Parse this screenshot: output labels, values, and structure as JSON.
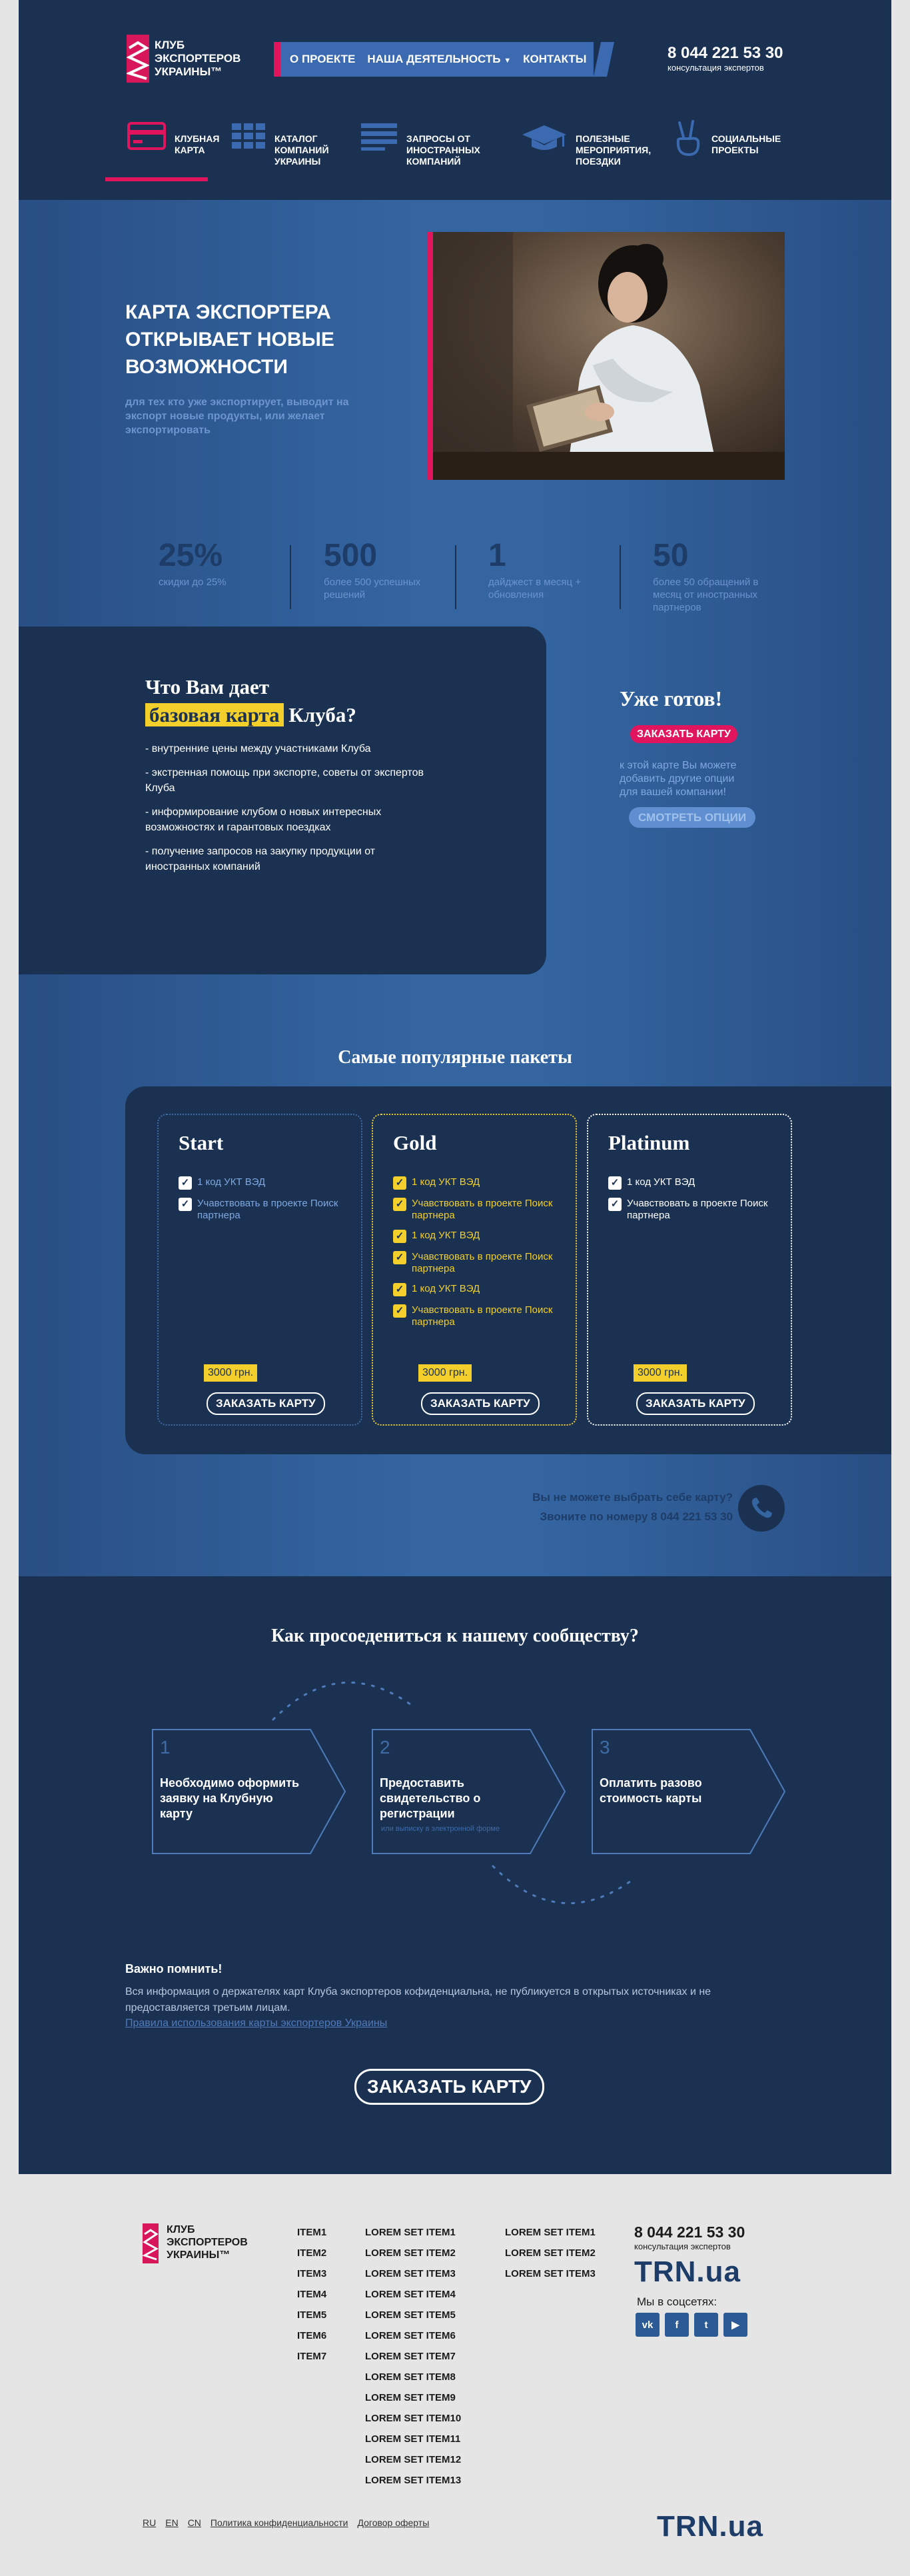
{
  "header": {
    "logo_lines": [
      "КЛУБ",
      "ЭКСПОРТЕРОВ",
      "УКРАИНЫ™"
    ],
    "nav": [
      "О ПРОЕКТЕ",
      "НАША ДЕЯТЕЛЬНОСТЬ",
      "КОНТАКТЫ"
    ],
    "phone": "8 044 221 53 30",
    "phone_caption": "консультация экспертов"
  },
  "services": [
    {
      "label": "КЛУБНАЯ КАРТА",
      "icon": "card-icon"
    },
    {
      "label": "КАТАЛОГ КОМПАНИЙ УКРАИНЫ",
      "icon": "grid-icon"
    },
    {
      "label": "ЗАПРОСЫ ОТ ИНОСТРАННЫХ КОМПАНИЙ",
      "icon": "list-icon"
    },
    {
      "label": "ПОЛЕЗНЫЕ МЕРОПРИЯТИЯ, ПОЕЗДКИ",
      "icon": "graduation-cap-icon"
    },
    {
      "label": "СОЦИАЛЬНЫЕ ПРОЕКТЫ",
      "icon": "peace-hand-icon"
    }
  ],
  "hero": {
    "title_lines": [
      "КАРТА ЭКСПОРТЕРА",
      "ОТКРЫВАЕТ НОВЫЕ",
      "ВОЗМОЖНОСТИ"
    ],
    "subtitle": "для тех кто уже экспортирует, выводит на экспорт новые продукты, или желает экспортировать"
  },
  "stats": [
    {
      "value": "25%",
      "label": "скидки до 25%"
    },
    {
      "value": "500",
      "label": "более 500 успешных решений"
    },
    {
      "value": "1",
      "label": "дайджест в месяц + обновления"
    },
    {
      "value": "50",
      "label": "более 50 обращений в месяц от иностранных партнеров"
    }
  ],
  "basic": {
    "title_before": "Что Вам дает",
    "title_highlight": "базовая карта",
    "title_after": "Клуба?",
    "items": [
      "- внутренние цены между участниками Клуба",
      "- экстренная помощь при экспорте, советы от экспертов Клуба",
      "- информирование клубом о новых интересных возможностях и гарантовых поездках",
      "- получение запросов на закупку продукции от иностранных компаний"
    ]
  },
  "ready": {
    "title": "Уже готов!",
    "order": "ЗАКАЗАТЬ КАРТУ",
    "note": "к этой карте Вы можете добавить другие опции для вашей компании!",
    "options": "СМОТРЕТЬ ОПЦИИ"
  },
  "packages": {
    "title": "Самые популярные пакеты",
    "items": [
      {
        "name": "Start",
        "features": [
          "1 код УКТ ВЭД",
          "Учавствовать в проекте Поиск партнера"
        ],
        "price": "3000 грн.",
        "button": "ЗАКАЗАТЬ КАРТУ"
      },
      {
        "name": "Gold",
        "features": [
          "1 код УКТ ВЭД",
          "Учавствовать в проекте Поиск партнера",
          "1 код УКТ ВЭД",
          "Учавствовать в проекте Поиск партнера",
          "1 код УКТ ВЭД",
          "Учавствовать в проекте Поиск партнера"
        ],
        "price": "3000 грн.",
        "button": "ЗАКАЗАТЬ КАРТУ"
      },
      {
        "name": "Platinum",
        "features": [
          "1 код УКТ ВЭД",
          "Учавствовать в проекте Поиск партнера"
        ],
        "price": "3000 грн.",
        "button": "ЗАКАЗАТЬ КАРТУ"
      }
    ],
    "cant_choose_line1": "Вы не можете выбрать себе карту?",
    "cant_choose_line2": "Звоните по номеру 8 044 221 53 30"
  },
  "join": {
    "title": "Как просоедениться к нашему сообществу?",
    "steps": [
      {
        "num": "1",
        "text": "Необходимо оформить заявку на Клубную карту",
        "hint": ""
      },
      {
        "num": "2",
        "text": "Предоставить свидетельство о регистрации",
        "hint": "или выписку в электронной форме"
      },
      {
        "num": "3",
        "text": "Оплатить разово стоимость карты",
        "hint": ""
      }
    ]
  },
  "notice": {
    "title": "Важно помнить!",
    "text": "Вся информация о держателях карт Клуба экспортеров кофиденциальна, не публикуется в открытых источниках и не предоставляется третьим лицам.",
    "link": "Правила использования карты экспортеров Украины",
    "button": "ЗАКАЗАТЬ КАРТУ"
  },
  "footer": {
    "logo_lines": [
      "КЛУБ",
      "ЭКСПОРТЕРОВ",
      "УКРАИНЫ™"
    ],
    "col1": [
      "ITEM1",
      "ITEM2",
      "ITEM3",
      "ITEM4",
      "ITEM5",
      "ITEM6",
      "ITEM7"
    ],
    "col2": [
      "LOREM SET ITEM1",
      "LOREM SET ITEM2",
      "LOREM SET ITEM3",
      "LOREM SET ITEM4",
      "LOREM SET ITEM5",
      "LOREM SET ITEM6",
      "LOREM SET ITEM7",
      "LOREM SET ITEM8",
      "LOREM SET ITEM9",
      "LOREM SET ITEM10",
      "LOREM SET ITEM11",
      "LOREM SET ITEM12",
      "LOREM SET ITEM13"
    ],
    "col3": [
      "LOREM SET ITEM1",
      "LOREM SET ITEM2",
      "LOREM SET ITEM3"
    ],
    "phone": "8 044 221 53 30",
    "phone_caption": "консультация экспертов",
    "brand": "TRN.ua",
    "social_title": "Мы в соцсетях:",
    "social": [
      "vk-icon",
      "facebook-icon",
      "twitter-icon",
      "youtube-icon"
    ],
    "bottom_links": [
      "RU",
      "EN",
      "CN",
      "Политика конфиденциальности",
      "Договор оферты"
    ],
    "brand_bottom": "TRN.ua"
  },
  "colors": {
    "accent": "#e0155e",
    "dark": "#1b3152",
    "blue": "#3465a1",
    "highlight": "#f2cf2a"
  }
}
